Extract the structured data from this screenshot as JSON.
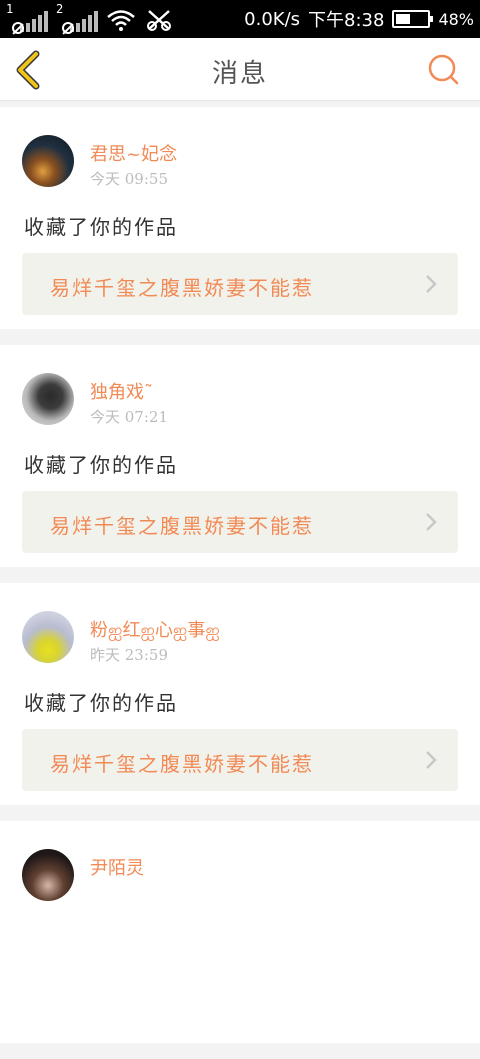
{
  "status_bar": {
    "sim1_label": "1",
    "sim2_label": "2",
    "net_speed": "0.0K/s",
    "clock": "下午8:38",
    "battery_text": "48%",
    "battery_level": 0.48,
    "icons": [
      "signal-1-icon",
      "signal-2-icon",
      "wifi-icon",
      "usb-debug-icon",
      "battery-icon"
    ]
  },
  "header": {
    "title": "消息",
    "back_icon": "chevron-left-icon",
    "search_icon": "search-icon",
    "accent_color": "#f28a55",
    "back_color": "#f0c419"
  },
  "messages": [
    {
      "user": "君思~妃念",
      "time": "今天 09:55",
      "action": "收藏了你的作品",
      "work_title": "易烊千玺之腹黑娇妻不能惹"
    },
    {
      "user": "独角戏˜",
      "time": "今天 07:21",
      "action": "收藏了你的作品",
      "work_title": "易烊千玺之腹黑娇妻不能惹"
    },
    {
      "user": "粉ஐ红ஐ心ஐ事ஐ",
      "time": "昨天 23:59",
      "action": "收藏了你的作品",
      "work_title": "易烊千玺之腹黑娇妻不能惹"
    },
    {
      "user": "尹陌灵",
      "time": "",
      "action": "",
      "work_title": ""
    }
  ]
}
